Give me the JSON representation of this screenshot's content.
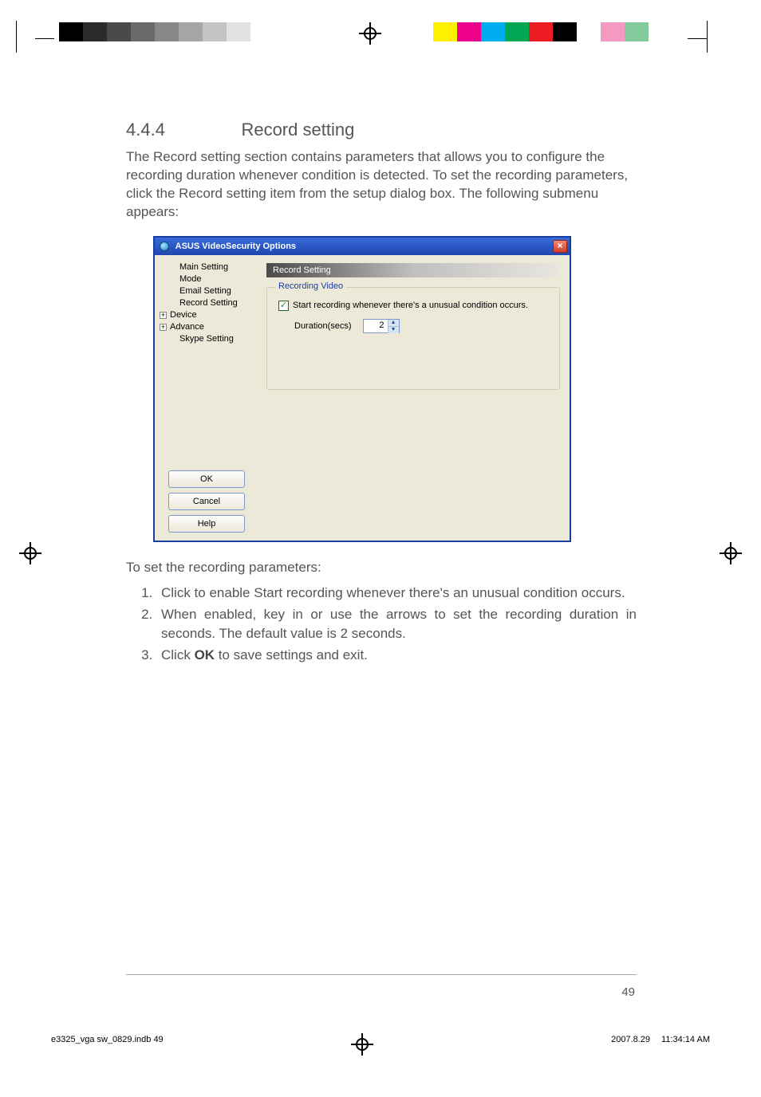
{
  "section": {
    "number": "4.4.4",
    "title": "Record setting"
  },
  "intro": "The Record setting section contains parameters that allows you to configure the recording duration whenever condition is detected. To set the recording parameters, click the Record setting item from the setup dialog box. The following submenu appears:",
  "window": {
    "title": "ASUS VideoSecurity Options",
    "close_glyph": "×",
    "tree": {
      "items": [
        {
          "label": "Main Setting",
          "expand": "none",
          "indent": 1
        },
        {
          "label": "Mode",
          "expand": "none",
          "indent": 1
        },
        {
          "label": "Email Setting",
          "expand": "none",
          "indent": 1
        },
        {
          "label": "Record Setting",
          "expand": "none",
          "indent": 1,
          "selected": true
        },
        {
          "label": "Device",
          "expand": "plus",
          "indent": 0
        },
        {
          "label": "Advance",
          "expand": "plus",
          "indent": 0
        },
        {
          "label": "Skype Setting",
          "expand": "none",
          "indent": 1
        }
      ]
    },
    "buttons": {
      "ok": "OK",
      "cancel": "Cancel",
      "help": "Help"
    },
    "panel": {
      "header": "Record Setting",
      "group_legend": "Recording Video",
      "checkbox_label": "Start recording whenever there's a unusual condition occurs.",
      "checkbox_checked": true,
      "duration_label": "Duration(secs)",
      "duration_value": "2"
    }
  },
  "steps_intro": "To set the recording parameters:",
  "steps": [
    "Click to enable Start recording whenever there's an unusual condition occurs.",
    "When enabled, key in or use the arrows to set the recording duration in seconds. The default value is 2 seconds.",
    {
      "pre": "Click ",
      "bold": "OK",
      "post": " to save settings and exit."
    }
  ],
  "page_number": "49",
  "footer": {
    "filename": "e3325_vga sw_0829.indb   49",
    "date": "2007.8.29",
    "time": "11:34:14 AM"
  },
  "colorbar_left": [
    "#000000",
    "#2b2b2b",
    "#4a4a4a",
    "#6a6a6a",
    "#888888",
    "#a6a6a6",
    "#c4c4c4",
    "#e2e2e2",
    "#ffffff",
    "#ffffff"
  ],
  "colorbar_right": [
    "#fff200",
    "#ec008c",
    "#00aeef",
    "#00a651",
    "#ed1c24",
    "#000000",
    "#ffffff",
    "#f49ac1",
    "#82ca9c",
    "#ffffff"
  ]
}
